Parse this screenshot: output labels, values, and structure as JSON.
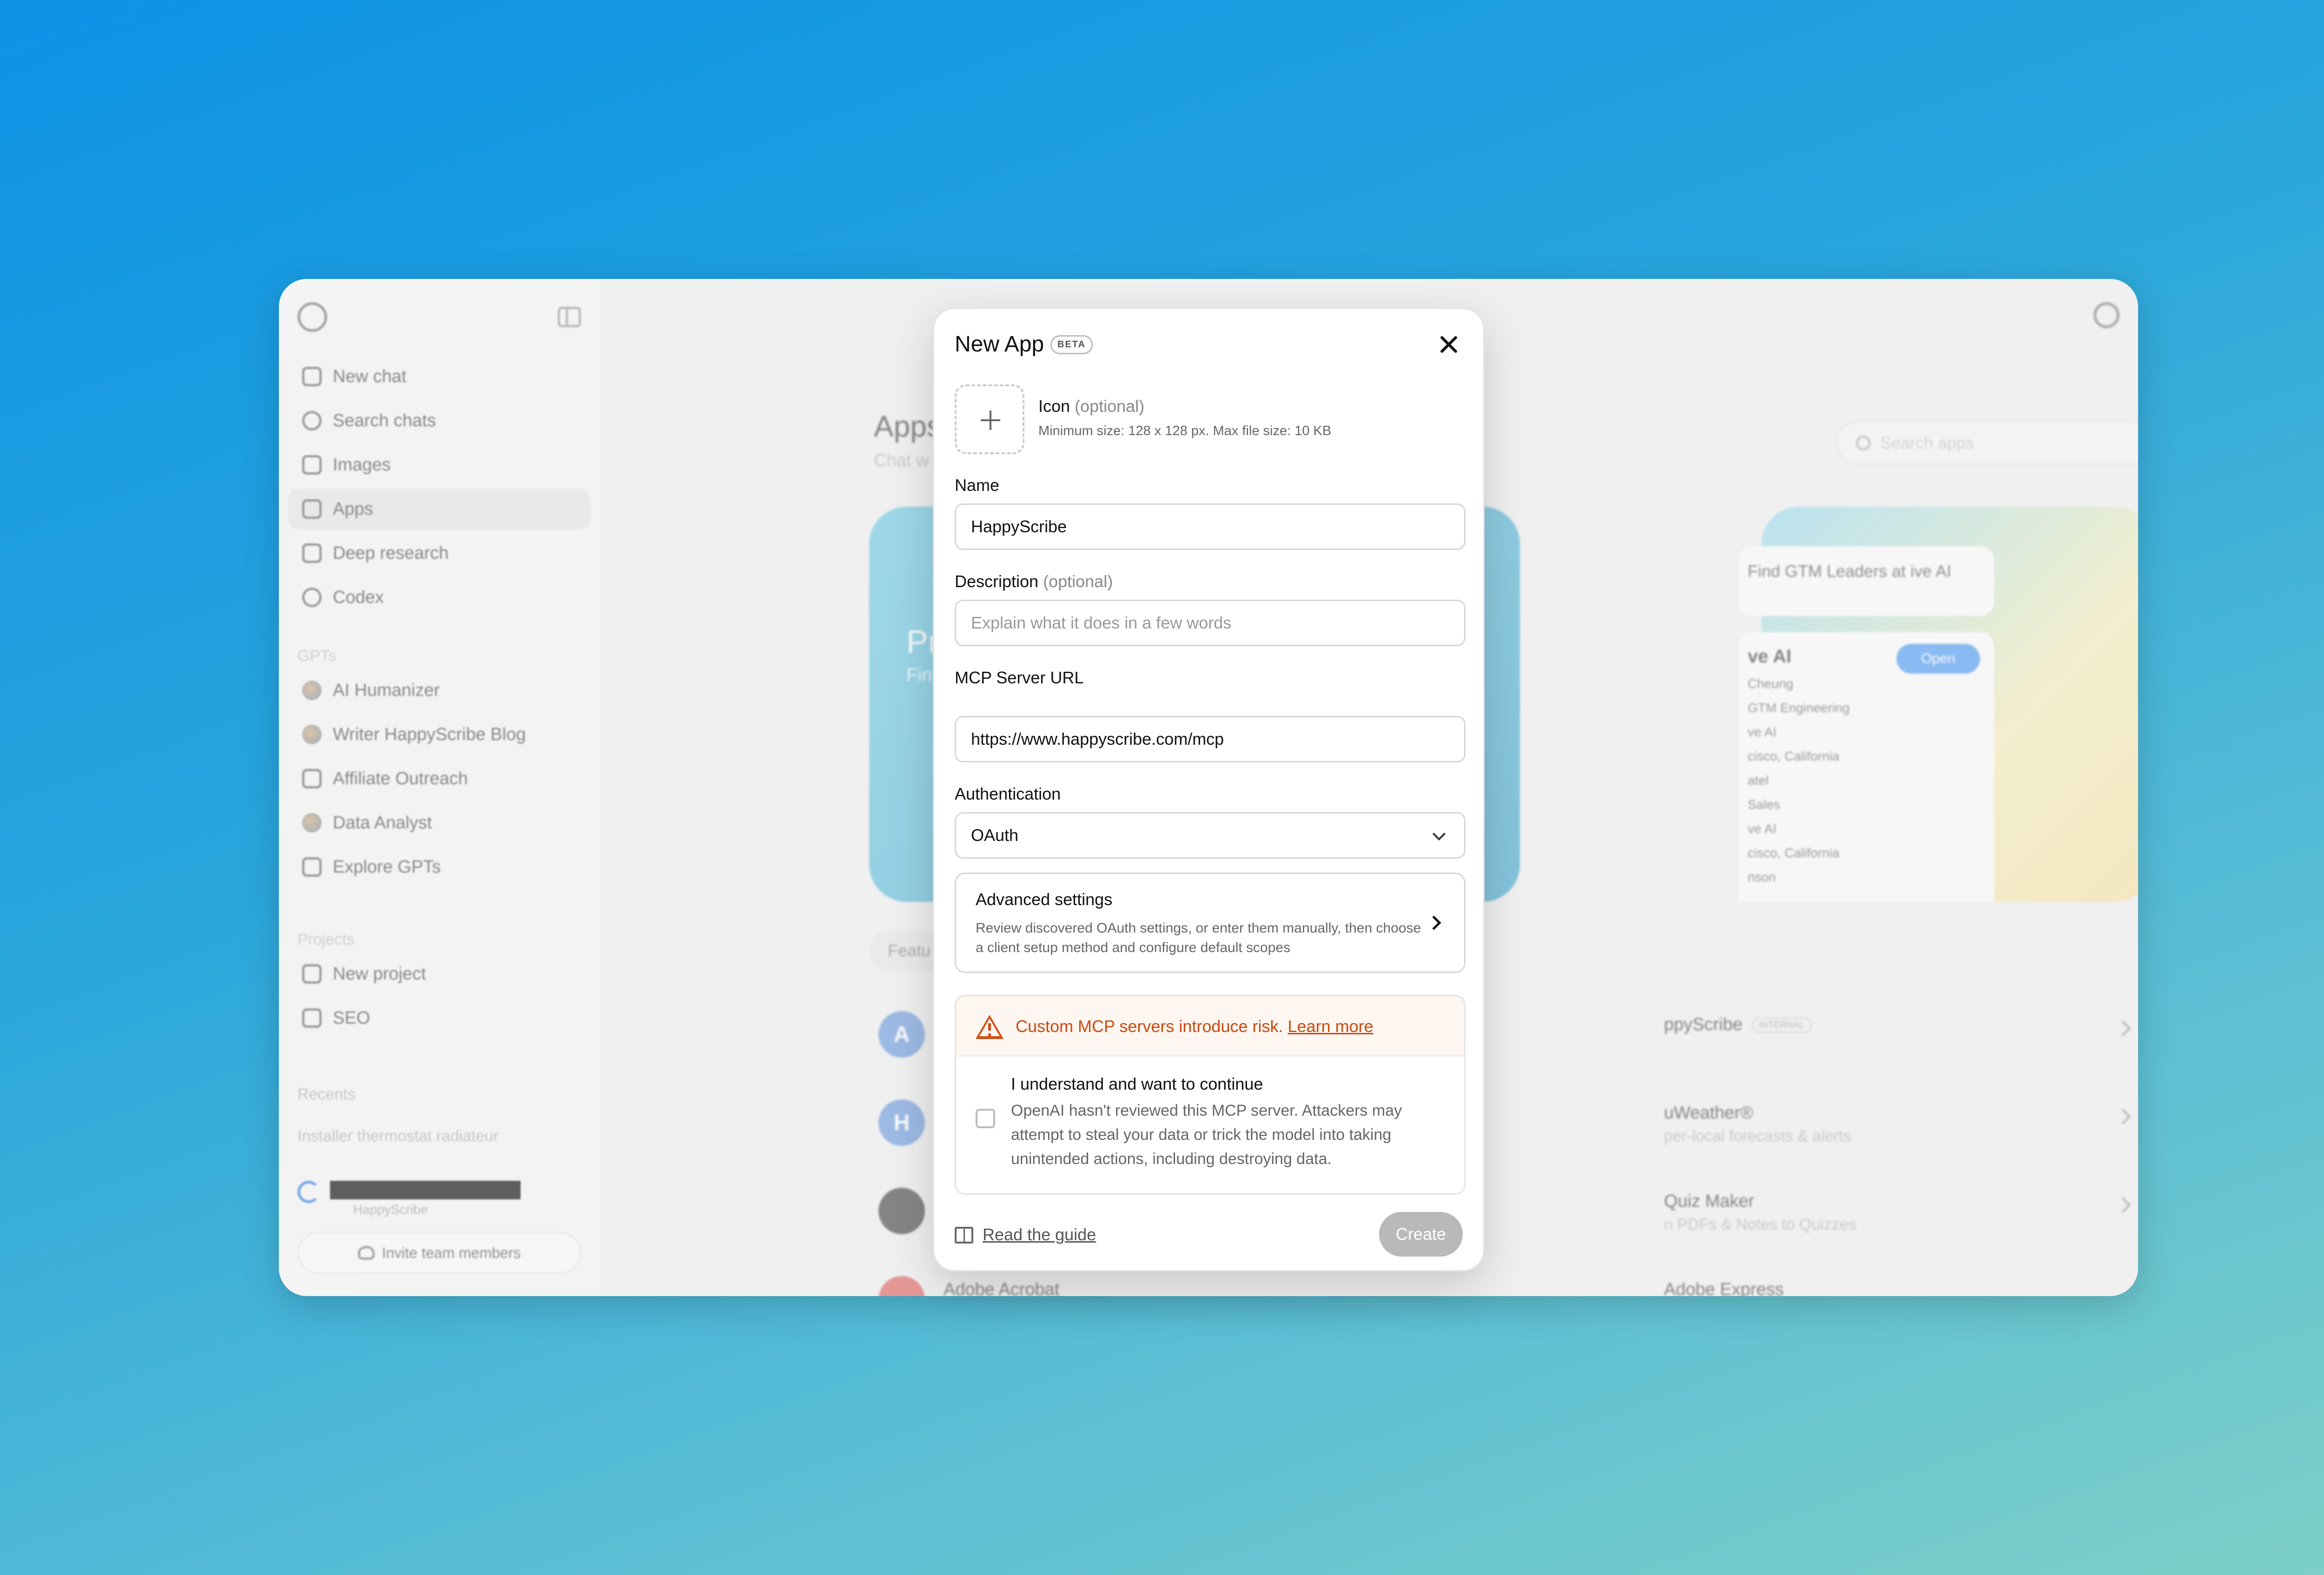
{
  "sidebar": {
    "nav": [
      {
        "label": "New chat",
        "icon": "edit-icon"
      },
      {
        "label": "Search chats",
        "icon": "search-icon"
      },
      {
        "label": "Images",
        "icon": "images-icon"
      },
      {
        "label": "Apps",
        "icon": "apps-grid-icon"
      },
      {
        "label": "Deep research",
        "icon": "telescope-icon"
      },
      {
        "label": "Codex",
        "icon": "codex-icon"
      }
    ],
    "gpts_heading": "GPTs",
    "gpts": [
      {
        "label": "AI Humanizer",
        "icon": "gpt-avatar-icon"
      },
      {
        "label": "Writer HappyScribe Blog",
        "icon": "gpt-avatar-icon"
      },
      {
        "label": "Affiliate Outreach",
        "icon": "cube-icon"
      },
      {
        "label": "Data Analyst",
        "icon": "gpt-avatar-icon"
      },
      {
        "label": "Explore GPTs",
        "icon": "cube-icon"
      }
    ],
    "projects_heading": "Projects",
    "projects": [
      {
        "label": "New project",
        "icon": "new-folder-icon"
      },
      {
        "label": "SEO",
        "icon": "folder-icon"
      }
    ],
    "recents_heading": "Recents",
    "recents": [
      "Installer thermostat radiateur"
    ],
    "user_sub": "HappyScribe",
    "invite_label": "Invite team members"
  },
  "main": {
    "title": "Apps",
    "subtitle": "Chat w",
    "search_placeholder": "Search apps",
    "hero_left_title": "Pr",
    "hero_left_sub": "Fin",
    "hero_card_text": "Find GTM Leaders at ive AI",
    "hero_card_title": "ve AI",
    "hero_open_label": "Open",
    "hero_lines": [
      "Cheung",
      "GTM Engineering",
      "ve AI",
      "cisco, California",
      "atel",
      "Sales",
      "ve AI",
      "cisco, California",
      "nson"
    ],
    "featured_label": "Featu",
    "apps": [
      {
        "avatar": "A",
        "color": "#5b8fd9",
        "name": "",
        "desc": ""
      },
      {
        "avatar": "H",
        "color": "#5b8fd9",
        "name": "",
        "desc": ""
      },
      {
        "avatar": "",
        "color": "#333333",
        "name": "",
        "desc": ""
      },
      {
        "avatar": "",
        "color": "#d9534f",
        "name": "Adobe Acrobat",
        "desc": ""
      }
    ],
    "apps_right": [
      {
        "name": "ppyScribe",
        "tag": "INTERNAL",
        "desc": ""
      },
      {
        "name": "uWeather®",
        "tag": "",
        "desc": "per-local forecasts & alerts"
      },
      {
        "name": "Quiz Maker",
        "tag": "",
        "desc": "n PDFs & Notes to Quizzes"
      },
      {
        "name": "Adobe Express",
        "tag": "",
        "desc": ""
      }
    ]
  },
  "modal": {
    "title": "New App",
    "badge": "BETA",
    "icon_label": "Icon",
    "optional_label": "(optional)",
    "icon_hint": "Minimum size: 128 x 128 px. Max file size: 10 KB",
    "name_label": "Name",
    "name_value": "HappyScribe",
    "description_label": "Description",
    "description_placeholder": "Explain what it does in a few words",
    "mcp_label": "MCP Server URL",
    "mcp_value": "https://www.happyscribe.com/mcp",
    "auth_label": "Authentication",
    "auth_value": "OAuth",
    "advanced_title": "Advanced settings",
    "advanced_desc": "Review discovered OAuth settings, or enter them manually, then choose a client setup method and configure default scopes",
    "warning_text": "Custom MCP servers introduce risk.",
    "warning_link": "Learn more",
    "ack_title": "I understand and want to continue",
    "ack_desc": "OpenAI hasn't reviewed this MCP server. Attackers may attempt to steal your data or trick the model into taking unintended actions, including destroying data.",
    "guide_label": "Read the guide",
    "create_label": "Create",
    "warning_color": "#c94a10"
  }
}
